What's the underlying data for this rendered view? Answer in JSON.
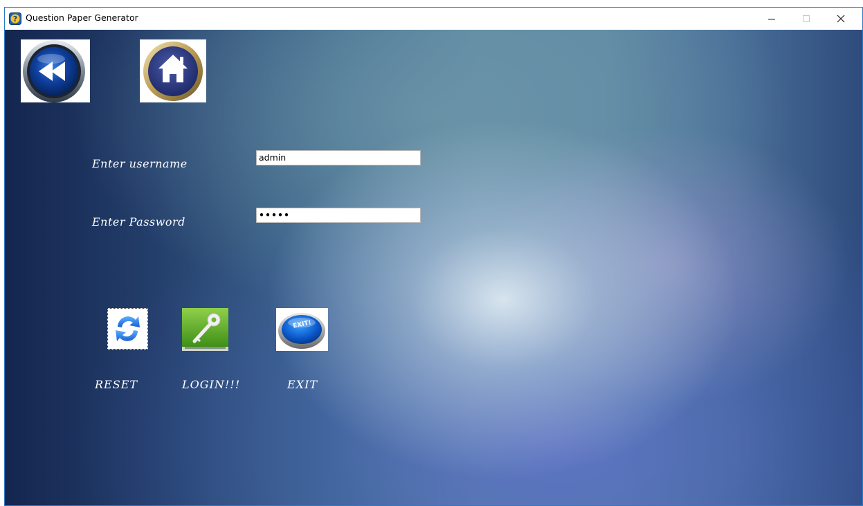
{
  "window": {
    "title": "Question Paper Generator"
  },
  "nav": {
    "back_icon": "rewind-back-icon",
    "home_icon": "home-icon"
  },
  "form": {
    "username_label": "Enter username",
    "username_value": "admin",
    "password_label": "Enter Password",
    "password_value": "•••••"
  },
  "actions": {
    "reset_label": "RESET",
    "login_label": "LOGIN!!!",
    "exit_label": "EXIT",
    "exit_badge": "EXIT!"
  },
  "colors": {
    "window_border": "#2b7bc4",
    "label_text": "#ffffff"
  }
}
